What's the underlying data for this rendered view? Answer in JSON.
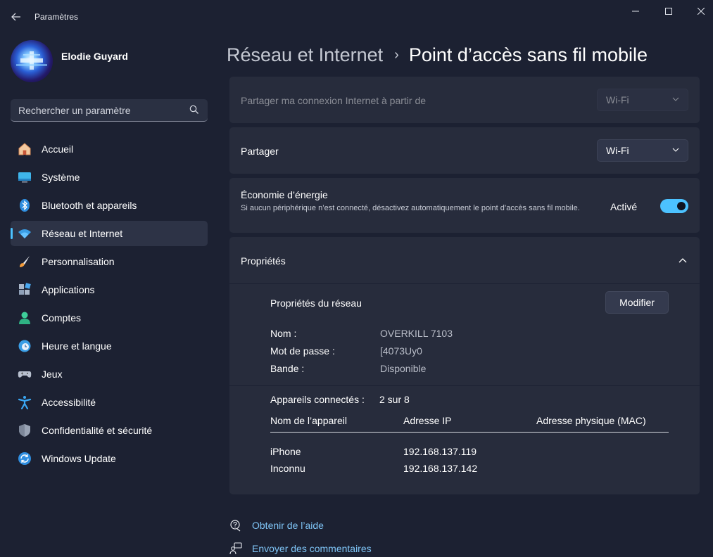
{
  "window": {
    "title": "Paramètres"
  },
  "profile": {
    "name": "Elodie Guyard"
  },
  "search": {
    "placeholder": "Rechercher un paramètre"
  },
  "nav": {
    "items": [
      {
        "label": "Accueil",
        "icon": "home-icon"
      },
      {
        "label": "Système",
        "icon": "system-icon"
      },
      {
        "label": "Bluetooth et appareils",
        "icon": "bluetooth-icon"
      },
      {
        "label": "Réseau et Internet",
        "icon": "wifi-icon",
        "active": true
      },
      {
        "label": "Personnalisation",
        "icon": "brush-icon"
      },
      {
        "label": "Applications",
        "icon": "apps-icon"
      },
      {
        "label": "Comptes",
        "icon": "account-icon"
      },
      {
        "label": "Heure et langue",
        "icon": "clock-icon"
      },
      {
        "label": "Jeux",
        "icon": "gamepad-icon"
      },
      {
        "label": "Accessibilité",
        "icon": "accessibility-icon"
      },
      {
        "label": "Confidentialité et sécurité",
        "icon": "shield-icon"
      },
      {
        "label": "Windows Update",
        "icon": "update-icon"
      }
    ]
  },
  "header": {
    "parent": "Réseau et Internet",
    "separator": "›",
    "current": "Point d’accès sans fil mobile"
  },
  "share_from": {
    "label": "Partager ma connexion Internet à partir de",
    "value": "Wi-Fi"
  },
  "share_over": {
    "label": "Partager",
    "value": "Wi-Fi"
  },
  "power_saving": {
    "title": "Économie d’énergie",
    "description": "Si aucun périphérique n’est connecté, désactivez automatiquement le point d’accès sans fil mobile.",
    "state_label": "Activé",
    "on": true
  },
  "properties": {
    "title": "Propriétés",
    "network_title": "Propriétés du réseau",
    "edit_label": "Modifier",
    "name_key": "Nom :",
    "name_value": "OVERKILL 7103",
    "password_key": "Mot de passe :",
    "password_value": "[4073Uy0",
    "band_key": "Bande :",
    "band_value": "Disponible",
    "connected_key": "Appareils connectés :",
    "connected_value": "2 sur 8",
    "columns": [
      "Nom de l’appareil",
      "Adresse IP",
      "Adresse physique (MAC)"
    ],
    "devices": [
      {
        "name": "iPhone",
        "ip": "192.168.137.119",
        "mac": ""
      },
      {
        "name": "Inconnu",
        "ip": "192.168.137.142",
        "mac": ""
      }
    ]
  },
  "footer": {
    "help": "Obtenir de l’aide",
    "feedback": "Envoyer des commentaires"
  },
  "colors": {
    "accent": "#4cc2ff",
    "background": "#1c2132",
    "card": "#272c3c",
    "link": "#7fc5f7"
  }
}
